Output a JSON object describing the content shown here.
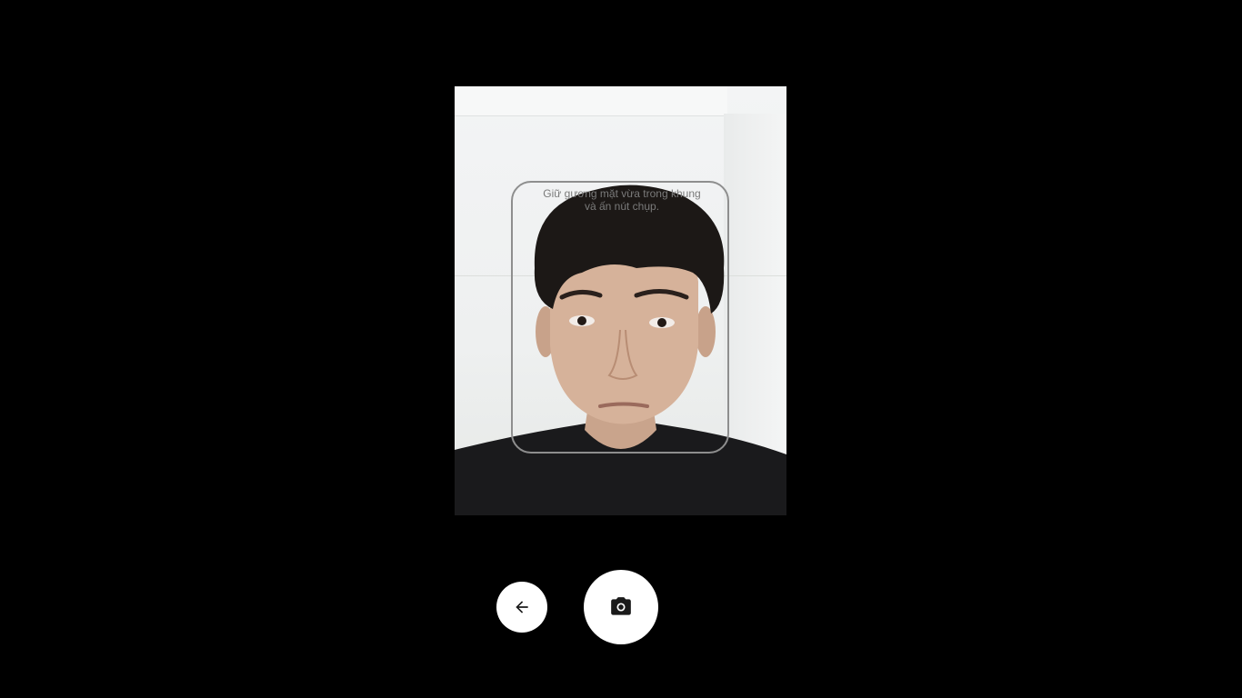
{
  "camera": {
    "instruction_line1": "Giữ gương mặt vừa trong khung",
    "instruction_line2": "và ấn nút chụp."
  },
  "controls": {
    "back_icon": "arrow-left-icon",
    "capture_icon": "camera-icon"
  },
  "colors": {
    "background": "#000000",
    "button": "#ffffff",
    "frame_border": "#8e8e8e"
  }
}
